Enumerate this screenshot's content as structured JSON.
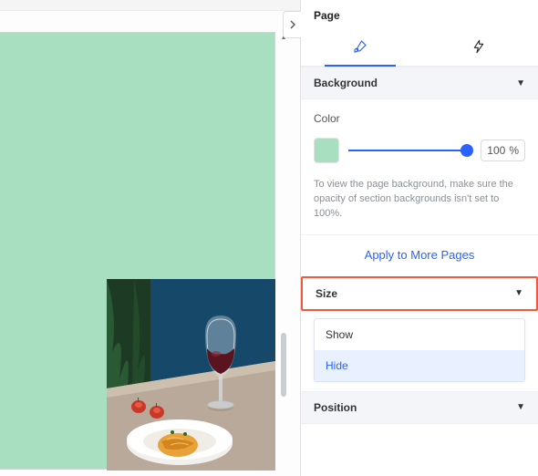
{
  "panel": {
    "title": "Page",
    "tabs": {
      "design_active": true
    },
    "background": {
      "header": "Background",
      "color_label": "Color",
      "swatch_hex": "#a7dfc0",
      "opacity_value": "100",
      "opacity_unit": "%",
      "hint": "To view the page background, make sure the opacity of section backgrounds isn't set to 100%.",
      "apply_link": "Apply to More Pages"
    },
    "size": {
      "header": "Size",
      "options": {
        "show": "Show",
        "hide": "Hide"
      }
    },
    "position": {
      "header": "Position"
    }
  }
}
